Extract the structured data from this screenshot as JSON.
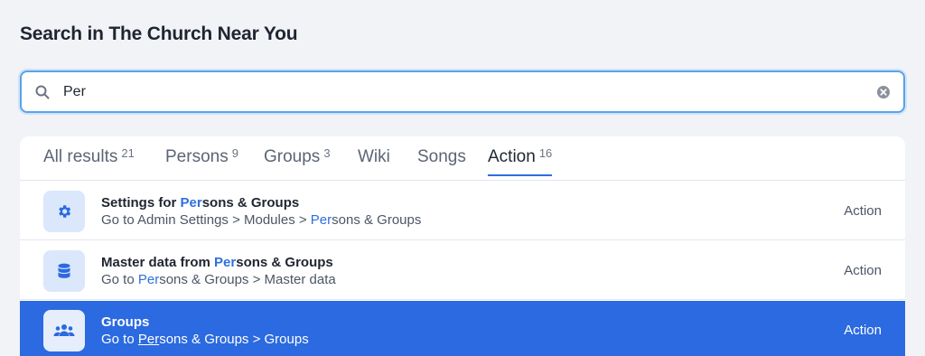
{
  "page": {
    "title": "Search in The Church Near You"
  },
  "search": {
    "value": "Per",
    "placeholder": ""
  },
  "tabs": [
    {
      "label": "All results",
      "count": "21"
    },
    {
      "label": "Persons",
      "count": "9"
    },
    {
      "label": "Groups",
      "count": "3"
    },
    {
      "label": "Wiki",
      "count": ""
    },
    {
      "label": "Songs",
      "count": ""
    },
    {
      "label": "Action",
      "count": "16",
      "active": true
    }
  ],
  "results": [
    {
      "icon": "gear-icon",
      "title_pre": "Settings for ",
      "title_hl": "Per",
      "title_post": "sons & Groups",
      "sub_pre": "Go to Admin Settings > Modules > ",
      "sub_hl": "Per",
      "sub_post": "sons & Groups",
      "type": "Action"
    },
    {
      "icon": "database-icon",
      "title_pre": "Master data from ",
      "title_hl": "Per",
      "title_post": "sons & Groups",
      "sub_pre": "Go to ",
      "sub_hl": "Per",
      "sub_post": "sons & Groups > Master data",
      "type": "Action"
    },
    {
      "icon": "users-group-icon",
      "title_pre": "Groups",
      "title_hl": "",
      "title_post": "",
      "sub_pre": "Go to ",
      "sub_hl": "Per",
      "sub_post": "sons & Groups > Groups",
      "type": "Action",
      "selected": true
    }
  ],
  "colors": {
    "accent": "#2b6ae0",
    "highlight": "#2f6fe0",
    "background": "#f1f3f7",
    "focus_ring": "#5aa3e8"
  }
}
